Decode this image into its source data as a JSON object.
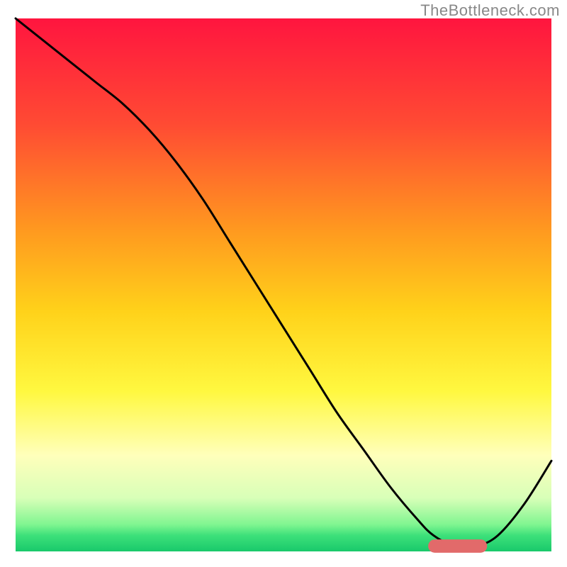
{
  "watermark": "TheBottleneck.com",
  "chart_data": {
    "type": "line",
    "title": "",
    "xlabel": "",
    "ylabel": "",
    "xlim": [
      0,
      100
    ],
    "ylim": [
      0,
      100
    ],
    "grid": false,
    "axes_visible": false,
    "background": {
      "type": "vertical-gradient",
      "stops": [
        {
          "offset": 0.0,
          "color": "#ff153f"
        },
        {
          "offset": 0.2,
          "color": "#ff4b33"
        },
        {
          "offset": 0.4,
          "color": "#ff9a1f"
        },
        {
          "offset": 0.55,
          "color": "#ffd21a"
        },
        {
          "offset": 0.7,
          "color": "#fff840"
        },
        {
          "offset": 0.82,
          "color": "#ffffbb"
        },
        {
          "offset": 0.9,
          "color": "#d8ffb8"
        },
        {
          "offset": 0.95,
          "color": "#7ff590"
        },
        {
          "offset": 0.97,
          "color": "#3de07a"
        },
        {
          "offset": 1.0,
          "color": "#19c96b"
        }
      ]
    },
    "series": [
      {
        "name": "bottleneck-curve",
        "color": "#000000",
        "width": 3,
        "x": [
          0,
          5,
          10,
          15,
          20,
          25,
          30,
          35,
          40,
          45,
          50,
          55,
          60,
          65,
          70,
          75,
          78,
          82,
          86,
          90,
          95,
          100
        ],
        "y": [
          100,
          96,
          92,
          88,
          84,
          79,
          73,
          66,
          58,
          50,
          42,
          34,
          26,
          19,
          12,
          6,
          3,
          1,
          1,
          3,
          9,
          17
        ]
      }
    ],
    "marker": {
      "name": "optimal-range",
      "shape": "rounded-bar",
      "color": "#e26a6a",
      "x_start": 77,
      "x_end": 88,
      "y": 1,
      "height": 2.5
    }
  }
}
